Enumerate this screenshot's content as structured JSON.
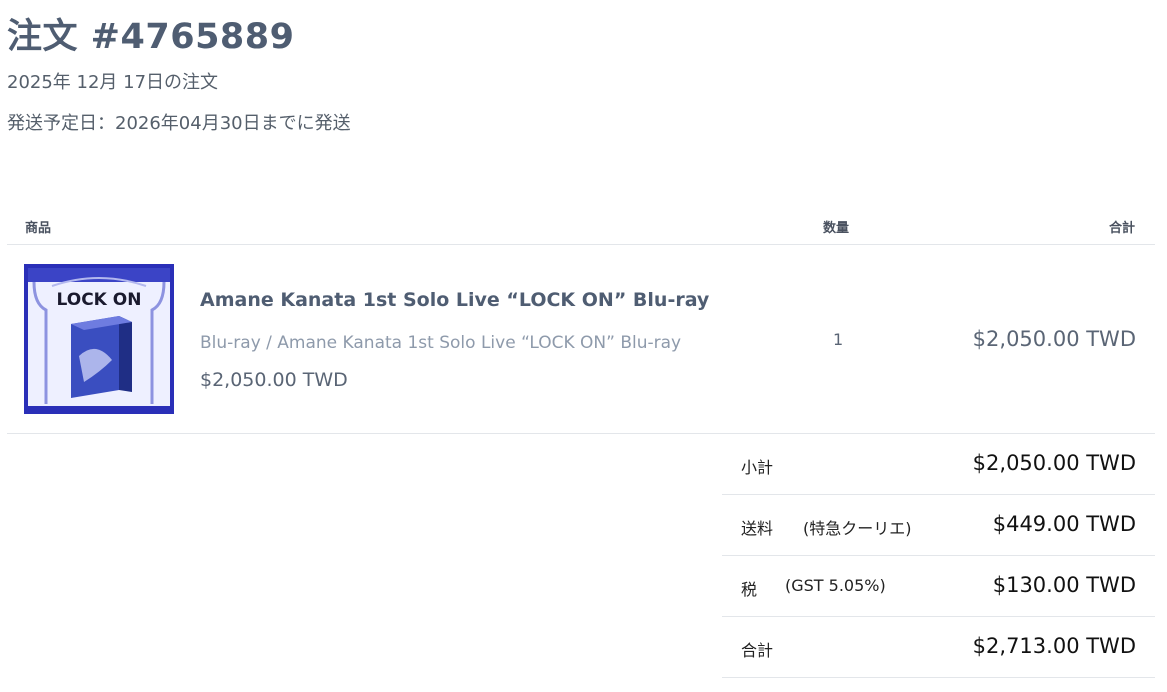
{
  "order": {
    "title": "注文 #4765889",
    "date": "2025年 12月 17日の注文",
    "shipping_date": "発送予定日：2026年04月30日までに発送"
  },
  "table": {
    "headers": {
      "product": "商品",
      "quantity": "数量",
      "total": "合計"
    }
  },
  "items": [
    {
      "name": "Amane Kanata 1st Solo Live “LOCK ON” Blu-ray",
      "variant": "Blu-ray / Amane Kanata 1st Solo Live “LOCK ON” Blu-ray",
      "price": "$2,050.00 TWD",
      "quantity": "1",
      "total": "$2,050.00 TWD",
      "thumbnail": {
        "logo_text": "LOCK ON",
        "colors": {
          "frame": "#2a2fb8",
          "bg": "#eef0ff",
          "box": "#3a4ec0"
        }
      }
    }
  ],
  "summary": {
    "subtotal": {
      "label": "小計",
      "value": "$2,050.00 TWD"
    },
    "shipping": {
      "label": "送料",
      "note": "(特急クーリエ)",
      "value": "$449.00 TWD"
    },
    "tax": {
      "label": "税",
      "note": "(GST 5.05%)",
      "value": "$130.00 TWD"
    },
    "total": {
      "label": "合計",
      "value": "$2,713.00 TWD"
    }
  }
}
